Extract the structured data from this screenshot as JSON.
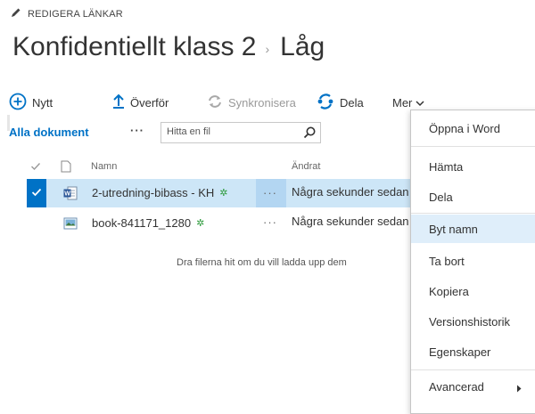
{
  "edit_links": {
    "label": "REDIGERA LÄNKAR"
  },
  "title": {
    "part1": "Konfidentiellt klass 2",
    "separator": "›",
    "part2": "Låg"
  },
  "toolbar": {
    "new_label": "Nytt",
    "upload_label": "Överför",
    "sync_label": "Synkronisera",
    "share_label": "Dela",
    "more_label": "Mer"
  },
  "view": {
    "all_documents": "Alla dokument",
    "ellipsis": "···",
    "search_placeholder": "Hitta en fil"
  },
  "columns": {
    "name": "Namn",
    "modified": "Ändrat"
  },
  "files": [
    {
      "name": "2-utredning-bibass - KH",
      "new_marker": "✲",
      "more": "···",
      "modified": "Några sekunder sedan",
      "selected": true,
      "type": "word-document"
    },
    {
      "name": "book-841171_1280",
      "new_marker": "✲",
      "more": "···",
      "modified": "Några sekunder sedan",
      "selected": false,
      "type": "image"
    }
  ],
  "drop_hint": "Dra filerna hit om du vill ladda upp dem",
  "context_menu": {
    "items": [
      {
        "label": "Öppna i Word"
      },
      {
        "label": "Hämta"
      },
      {
        "label": "Dela"
      },
      {
        "label": "Byt namn",
        "highlighted": true
      },
      {
        "label": "Ta bort"
      },
      {
        "label": "Kopiera"
      },
      {
        "label": "Versionshistorik"
      },
      {
        "label": "Egenskaper"
      },
      {
        "label": "Avancerad",
        "has_submenu": true
      }
    ]
  },
  "colors": {
    "accent": "#0072c6",
    "selected_row": "#cde6f7",
    "menu_highlight": "#dfeefa",
    "new_marker": "#2e9b3c"
  }
}
